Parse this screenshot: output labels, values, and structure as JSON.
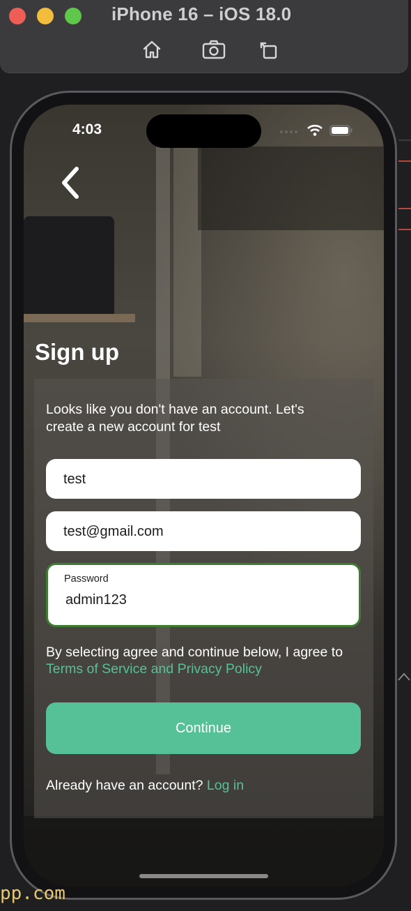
{
  "simulator": {
    "title": "iPhone 16 – iOS 18.0",
    "buttons": [
      {
        "name": "home-icon"
      },
      {
        "name": "screenshot-icon"
      },
      {
        "name": "rotate-icon"
      }
    ],
    "traffic_colors": {
      "close": "#ee5d56",
      "minimize": "#f2bd3c",
      "zoom": "#5fc84a"
    }
  },
  "status_bar": {
    "time": "4:03"
  },
  "screen": {
    "back_icon": "chevron-left-icon",
    "title": "Sign up",
    "intro": "Looks like you don't have an account. Let's create a new account for test",
    "fields": {
      "name": {
        "value": "test"
      },
      "email": {
        "value": "test@gmail.com"
      },
      "password": {
        "label": "Password",
        "value": "admin123"
      }
    },
    "terms": {
      "text": "By selecting agree and continue below, I agree to",
      "link": "Terms of Service and Privacy Policy"
    },
    "continue_label": "Continue",
    "login": {
      "prompt": "Already have an account?",
      "link": "Log in"
    }
  },
  "background_code_fragment": "pp.com",
  "colors": {
    "accent": "#56c196",
    "focus_border": "#3f7d33",
    "card": "rgba(88,84,80,0.55)"
  }
}
